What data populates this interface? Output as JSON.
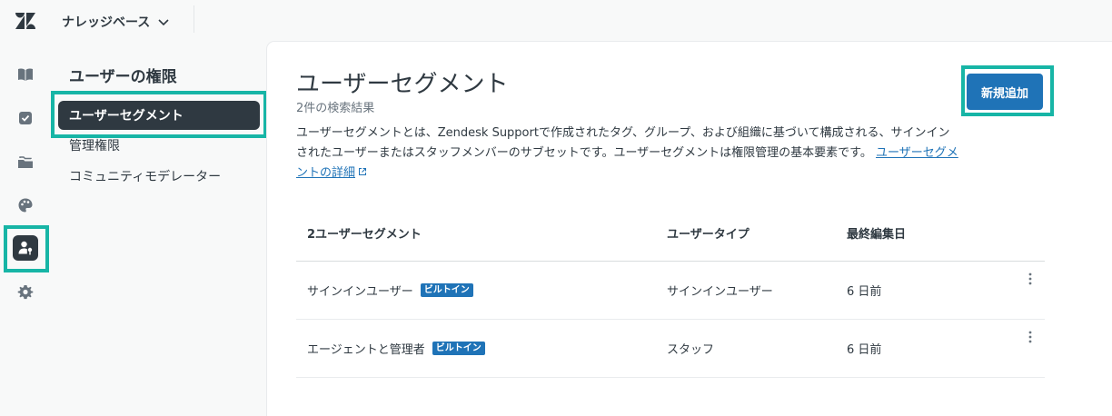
{
  "topbar": {
    "product_name": "ナレッジベース"
  },
  "rail": {
    "items": [
      {
        "icon": "book-icon"
      },
      {
        "icon": "checkbox-icon"
      },
      {
        "icon": "folder-icon"
      },
      {
        "icon": "palette-icon"
      },
      {
        "icon": "user-key-icon",
        "active": true
      },
      {
        "icon": "gear-icon"
      }
    ]
  },
  "subnav": {
    "title": "ユーザーの権限",
    "items": [
      {
        "label": "ユーザーセグメント",
        "active": true
      },
      {
        "label": "管理権限"
      },
      {
        "label": "コミュニティモデレーター"
      }
    ]
  },
  "main": {
    "title": "ユーザーセグメント",
    "result_count": "2件の検索結果",
    "description": "ユーザーセグメントとは、Zendesk Supportで作成されたタグ、グループ、および組織に基づいて構成される、サインインされたユーザーまたはスタッフメンバーのサブセットです。ユーザーセグメントは権限管理の基本要素です。",
    "details_link": "ユーザーセグメントの詳細",
    "add_button": "新規追加"
  },
  "table": {
    "headers": [
      "2ユーザーセグメント",
      "ユーザータイプ",
      "最終編集日"
    ],
    "rows": [
      {
        "name": "サインインユーザー",
        "badge": "ビルトイン",
        "type": "サインインユーザー",
        "edited": "6 日前"
      },
      {
        "name": "エージェントと管理者",
        "badge": "ビルトイン",
        "type": "スタッフ",
        "edited": "6 日前"
      }
    ]
  },
  "colors": {
    "accent": "#1f73b7",
    "highlight": "#17b5a6",
    "dark": "#2f3941"
  }
}
